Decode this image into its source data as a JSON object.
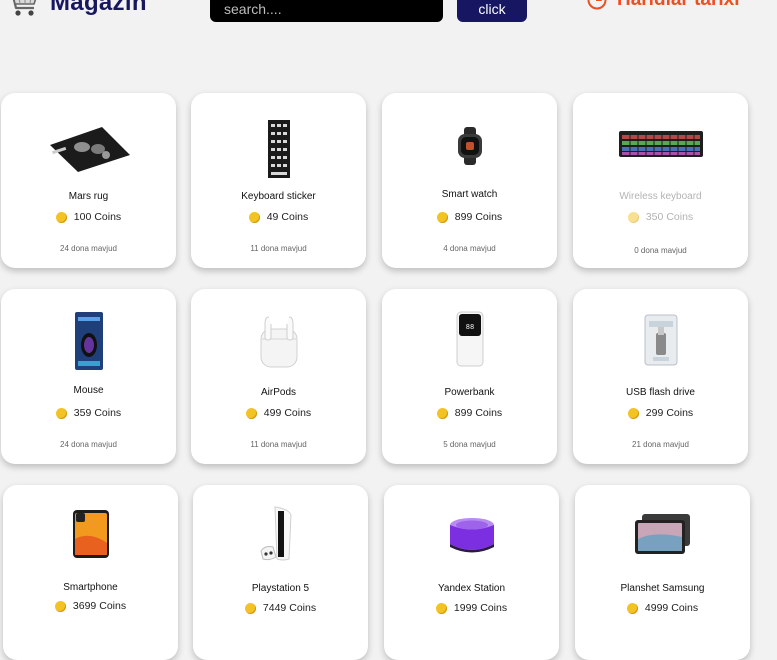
{
  "header": {
    "brand": "Magazin",
    "search_placeholder": "search....",
    "search_button": "click",
    "history_label": "Haridlar tarixi"
  },
  "colors": {
    "brand": "#17175f",
    "button": "#161663",
    "history": "#ef4e1f",
    "coin": "#f3c324"
  },
  "products": [
    {
      "name": "Mars rug",
      "price": "100",
      "currency": "Coins",
      "stock": "24 dona mavjud",
      "icon": "mouse-pad-icon"
    },
    {
      "name": "Keyboard sticker",
      "price": "49",
      "currency": "Coins",
      "stock": "11 dona mavjud",
      "icon": "keyboard-sticker-icon"
    },
    {
      "name": "Smart watch",
      "price": "899",
      "currency": "Coins",
      "stock": "4 dona mavjud",
      "icon": "smart-watch-icon"
    },
    {
      "name": "Wireless keyboard",
      "price": "350",
      "currency": "Coins",
      "stock": "0 dona mavjud",
      "icon": "keyboard-icon"
    },
    {
      "name": "Mouse",
      "price": "359",
      "currency": "Coins",
      "stock": "24 dona mavjud",
      "icon": "mouse-box-icon"
    },
    {
      "name": "AirPods",
      "price": "499",
      "currency": "Coins",
      "stock": "11 dona mavjud",
      "icon": "airpods-icon"
    },
    {
      "name": "Powerbank",
      "price": "899",
      "currency": "Coins",
      "stock": "5 dona mavjud",
      "icon": "powerbank-icon"
    },
    {
      "name": "USB flash drive",
      "price": "299",
      "currency": "Coins",
      "stock": "21 dona mavjud",
      "icon": "usb-drive-icon"
    },
    {
      "name": "Smartphone",
      "price": "3699",
      "currency": "Coins",
      "stock": "",
      "icon": "smartphone-icon"
    },
    {
      "name": "Playstation 5",
      "price": "7449",
      "currency": "Coins",
      "stock": "",
      "icon": "game-console-icon"
    },
    {
      "name": "Yandex Station",
      "price": "1999",
      "currency": "Coins",
      "stock": "",
      "icon": "smart-speaker-icon"
    },
    {
      "name": "Planshet Samsung",
      "price": "4999",
      "currency": "Coins",
      "stock": "",
      "icon": "tablet-icon"
    }
  ]
}
